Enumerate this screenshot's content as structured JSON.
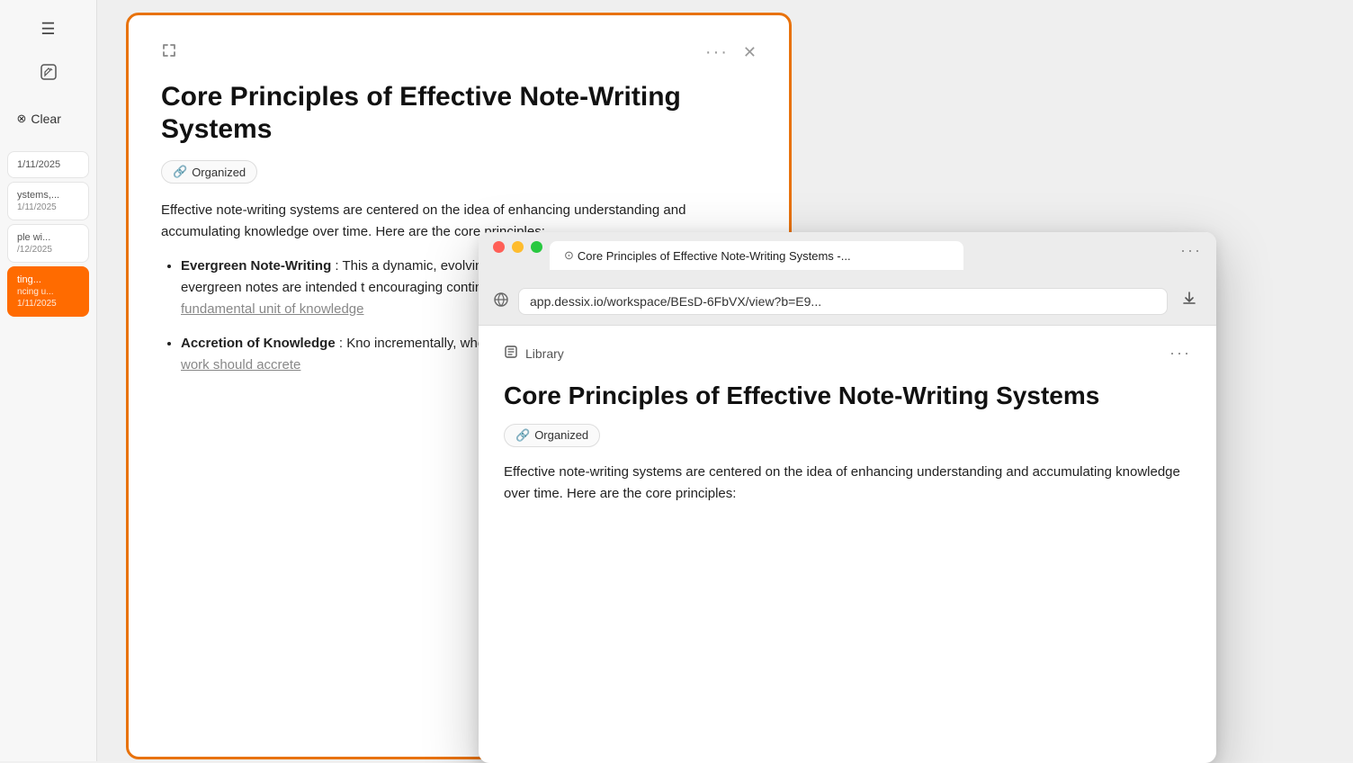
{
  "sidebar": {
    "icons": [
      {
        "name": "menu-icon",
        "symbol": "☰",
        "label": "Menu"
      },
      {
        "name": "edit-icon",
        "symbol": "✎",
        "label": "Edit"
      }
    ],
    "clear_label": "Clear",
    "items": [
      {
        "title": "1/11/2025",
        "date": "1/11/2025",
        "active": false
      },
      {
        "title": "ystems,...",
        "date": "1/11/2025",
        "active": false
      },
      {
        "title": "ple wi...",
        "date": "/12/2025",
        "active": false
      },
      {
        "title": "ting...",
        "subtitle": "ncing u...",
        "date": "1/11/2025",
        "active": true
      }
    ]
  },
  "card": {
    "title": "Core Principles of Effective Note-Writing Systems",
    "badge": "Organized",
    "badge_icon": "🔗",
    "intro": "Effective note-writing systems are centered on the idea of enhancing understanding and accumulating knowledge over time. Here are the core principles:",
    "list_items": [
      {
        "heading": "Evergreen Note-Writing",
        "body": ": This a dynamic, evolving entities that time. Unlike transient notes, wh evergreen notes are intended t encouraging continuous engag This principle is emphasized in",
        "link_text": "fundamental unit of knowledge"
      },
      {
        "heading": "Accretion of Knowledge",
        "body": ": Kno incrementally, where each note of knowledge. This concept is h",
        "link_text": "work should accrete"
      }
    ]
  },
  "browser": {
    "tab_title": "Core Principles of Effective Note-Writing Systems -...",
    "tab_icon": "⊙",
    "address": "app.dessix.io/workspace/BEsD-6FbVX/view?b=E9...",
    "breadcrumb_label": "Library",
    "breadcrumb_icon": "▤",
    "doc_title": "Core Principles of Effective Note-Writing Systems",
    "badge": "Organized",
    "badge_icon": "🔗",
    "body_text": "Effective note-writing systems are centered on the idea of enhancing understanding and accumulating knowledge over time. Here are the core principles:"
  }
}
